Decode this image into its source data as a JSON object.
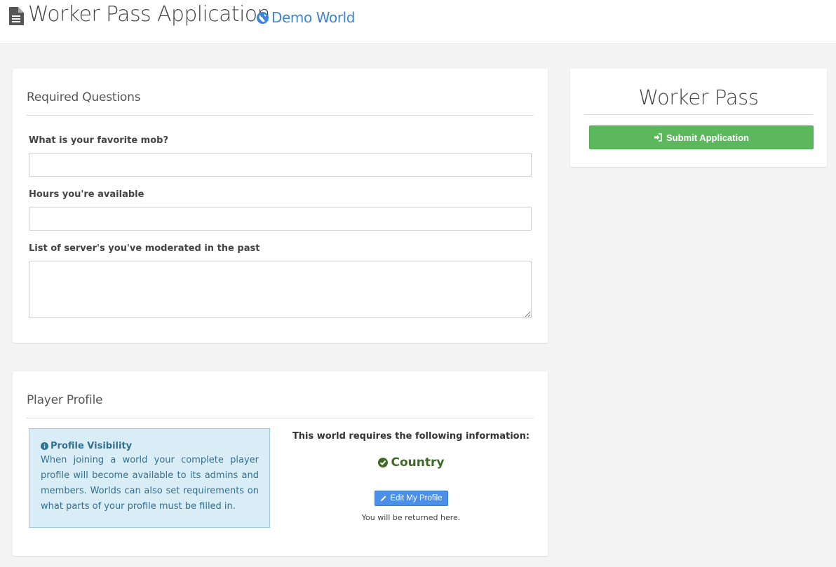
{
  "header": {
    "title": "Worker Pass Application",
    "world_name": "Demo World",
    "icons": [
      "file-icon",
      "globe-icon"
    ]
  },
  "questions": {
    "title": "Required Questions",
    "items": [
      {
        "label": "What is your favorite mob?",
        "value": ""
      },
      {
        "label": "Hours you're available",
        "value": ""
      },
      {
        "label": "List of server's you've moderated in the past",
        "value": ""
      }
    ]
  },
  "profile": {
    "title": "Player Profile",
    "visibility": {
      "title": "Profile Visibility",
      "text": "When joining a world your complete player profile will become available to its admins and members. Worlds can also set requirements on what parts of your profile must be filled in."
    },
    "requirements": {
      "heading": "This world requires the following information:",
      "items": [
        "Country"
      ]
    },
    "edit_button": "Edit My Profile",
    "return_note": "You will be returned here."
  },
  "sidebar": {
    "title": "Worker Pass",
    "submit_label": "Submit Application"
  },
  "colors": {
    "link": "#3a85d8",
    "submit": "#5cb85c",
    "edit_button": "#4c8fe6",
    "info_bg": "#d9edf7",
    "info_text": "#31708f",
    "check": "#3d6b27"
  }
}
